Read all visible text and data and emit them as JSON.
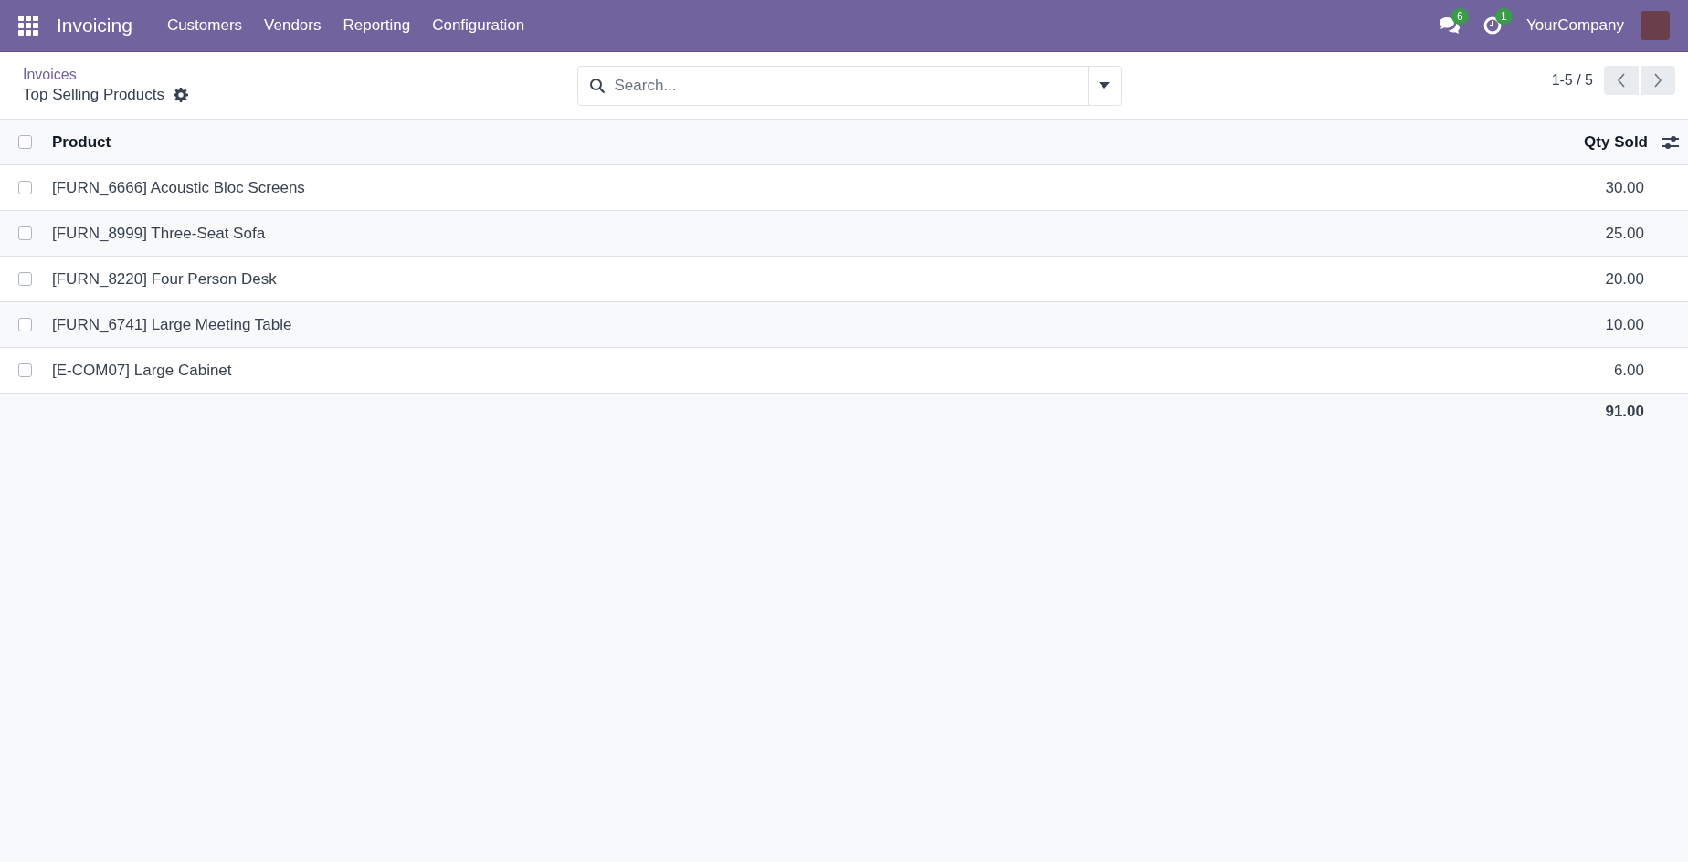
{
  "navbar": {
    "app_name": "Invoicing",
    "menu": [
      "Customers",
      "Vendors",
      "Reporting",
      "Configuration"
    ],
    "messages_badge": "6",
    "activities_badge": "1",
    "company": "YourCompany"
  },
  "control_panel": {
    "breadcrumb": "Invoices",
    "title": "Top Selling Products",
    "search": {
      "placeholder": "Search..."
    },
    "pager": "1-5 / 5"
  },
  "table": {
    "select_all": {
      "checked": false
    },
    "columns": [
      "Product",
      "Qty Sold"
    ],
    "rows": [
      {
        "product": "[FURN_6666] Acoustic Bloc Screens",
        "qty": "30.00",
        "selected": false
      },
      {
        "product": "[FURN_8999] Three-Seat Sofa",
        "qty": "25.00",
        "selected": false
      },
      {
        "product": "[FURN_8220] Four Person Desk",
        "qty": "20.00",
        "selected": false
      },
      {
        "product": "[FURN_6741] Large Meeting Table",
        "qty": "10.00",
        "selected": false
      },
      {
        "product": "[E-COM07] Large Cabinet",
        "qty": "6.00",
        "selected": false
      }
    ],
    "total": "91.00"
  }
}
